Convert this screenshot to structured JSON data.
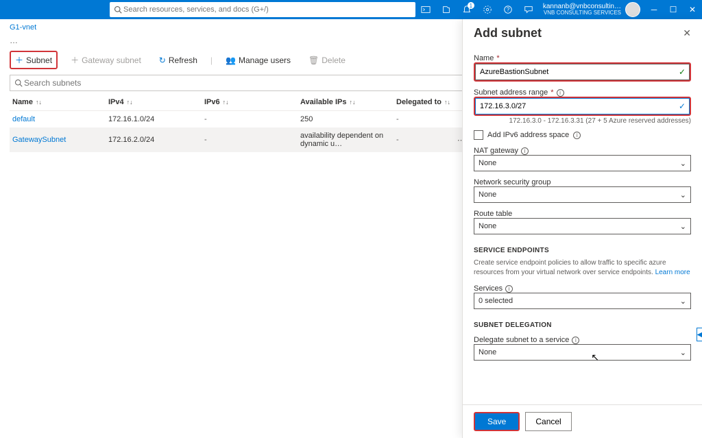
{
  "header": {
    "search_placeholder": "Search resources, services, and docs (G+/)",
    "notification_count": "1",
    "account_email": "kannanb@vnbconsultin…",
    "account_org": "VNB CONSULTING SERVICES"
  },
  "breadcrumb": "G1-vnet",
  "toolbar": {
    "subnet": "Subnet",
    "gateway_subnet": "Gateway subnet",
    "refresh": "Refresh",
    "manage_users": "Manage users",
    "delete": "Delete"
  },
  "filter": {
    "placeholder": "Search subnets"
  },
  "table": {
    "headers": {
      "name": "Name",
      "ipv4": "IPv4",
      "ipv6": "IPv6",
      "available": "Available IPs",
      "delegated": "Delegated to"
    },
    "rows": [
      {
        "name": "default",
        "ipv4": "172.16.1.0/24",
        "ipv6": "-",
        "available": "250",
        "delegated": "-"
      },
      {
        "name": "GatewaySubnet",
        "ipv4": "172.16.2.0/24",
        "ipv6": "-",
        "available": "availability dependent on dynamic u…",
        "delegated": "-"
      }
    ]
  },
  "panel": {
    "title": "Add subnet",
    "name_label": "Name",
    "name_value": "AzureBastionSubnet",
    "addr_label": "Subnet address range",
    "addr_value": "172.16.3.0/27",
    "addr_hint": "172.16.3.0 - 172.16.3.31 (27 + 5 Azure reserved addresses)",
    "add_ipv6": "Add IPv6 address space",
    "nat_label": "NAT gateway",
    "nsg_label": "Network security group",
    "route_label": "Route table",
    "section_endpoints": "SERVICE ENDPOINTS",
    "endpoints_desc": "Create service endpoint policies to allow traffic to specific azure resources from your virtual network over service endpoints. ",
    "learn_more": "Learn more",
    "services_label": "Services",
    "services_value": "0 selected",
    "section_delegation": "SUBNET DELEGATION",
    "delegate_label": "Delegate subnet to a service",
    "none_value": "None",
    "save": "Save",
    "cancel": "Cancel"
  }
}
